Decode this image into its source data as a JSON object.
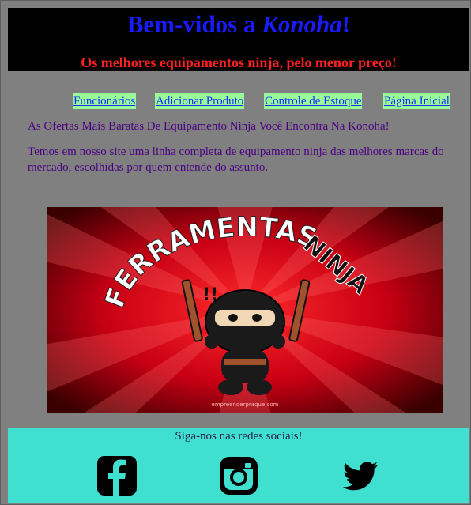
{
  "header": {
    "title_prefix": "Bem-vidos a ",
    "title_emphasis": "Konoha",
    "title_suffix": "!",
    "subtitle": "Os melhores equipamentos ninja, pelo menor preço!"
  },
  "nav": {
    "items": [
      {
        "label": "Funcionários"
      },
      {
        "label": "Adicionar Produto"
      },
      {
        "label": "Controle de Estoque"
      },
      {
        "label": "Página Inicial"
      }
    ]
  },
  "intro": {
    "headline": "As Ofertas Mais Baratas De Equipamento Ninja Você Encontra Na Konoha!",
    "body": "Temos em nosso site uma linha completa de equipamento ninja das melhores marcas do mercado, escolhidas por quem entende do assunto."
  },
  "banner": {
    "line1": "FERRAMENTAS",
    "line2": "NINJA",
    "exclaim": "!!",
    "credit": "empreenderpraque.com"
  },
  "footer": {
    "label": "Siga-nos nas redes sociais!",
    "icons": [
      "facebook-icon",
      "instagram-icon",
      "twitter-icon"
    ]
  },
  "colors": {
    "page_bg": "#808080",
    "header_bg": "#000000",
    "title": "#1a1aff",
    "subtitle": "#ff2020",
    "nav_bg": "#98fb98",
    "text": "#4b0082",
    "footer_bg": "#40e0d0"
  }
}
